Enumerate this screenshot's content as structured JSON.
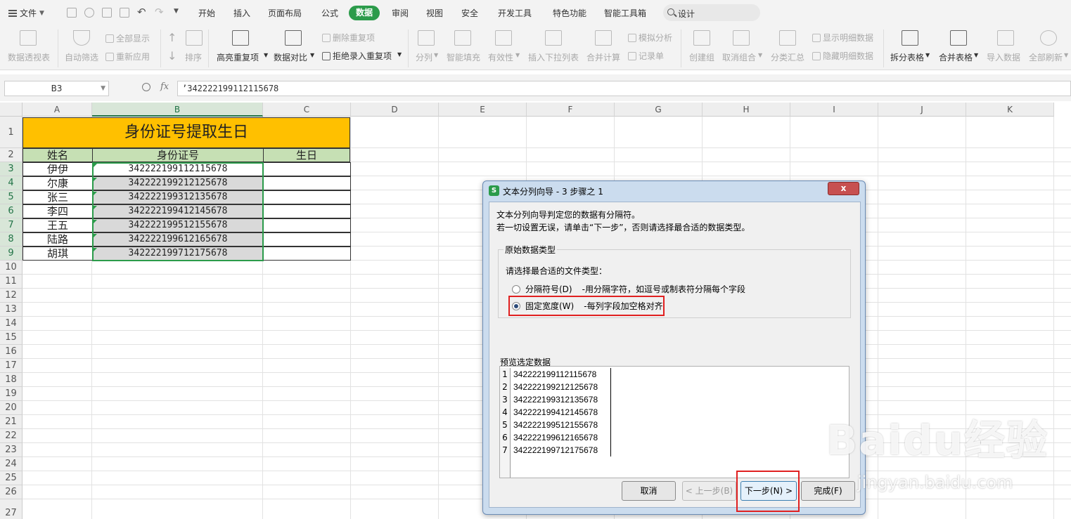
{
  "menubar": {
    "file": "文件",
    "tabs": [
      "开始",
      "插入",
      "页面布局",
      "公式",
      "数据",
      "审阅",
      "视图",
      "安全",
      "开发工具",
      "特色功能",
      "智能工具箱"
    ],
    "active_tab": "数据",
    "search_placeholder": "设计"
  },
  "ribbon": {
    "pivot": "数据透视表",
    "autofilter": "自动筛选",
    "show_all": "全部显示",
    "reapply": "重新应用",
    "sort": "排序",
    "highlight_dup": "高亮重复项",
    "data_compare": "数据对比",
    "remove_dup": "删除重复项",
    "reject_dup": "拒绝录入重复项",
    "split": "分列",
    "smart_fill": "智能填充",
    "validity": "有效性",
    "insert_dropdown": "插入下拉列表",
    "consolidate": "合并计算",
    "simulate": "模拟分析",
    "record": "记录单",
    "create_group": "创建组",
    "ungroup": "取消组合",
    "subtotal": "分类汇总",
    "show_detail": "显示明细数据",
    "hide_detail": "隐藏明细数据",
    "split_table": "拆分表格",
    "merge_table": "合并表格",
    "import_data": "导入数据",
    "refresh_all": "全部刷新"
  },
  "formula_bar": {
    "cell_ref": "B3",
    "fx": "fx",
    "content": "’342222199112115678"
  },
  "sheet": {
    "columns": [
      "A",
      "B",
      "C",
      "D",
      "E",
      "F",
      "G",
      "H",
      "I",
      "J",
      "K"
    ],
    "rows": [
      "1",
      "2",
      "3",
      "4",
      "5",
      "6",
      "7",
      "8",
      "9",
      "10",
      "11",
      "12",
      "13",
      "14",
      "15",
      "16",
      "17",
      "18",
      "19",
      "20",
      "21",
      "22",
      "23",
      "24",
      "25",
      "26",
      "27"
    ],
    "title": "身份证号提取生日",
    "headers": [
      "姓名",
      "身份证号",
      "生日"
    ],
    "records": [
      {
        "name": "伊伊",
        "id": "342222199112115678",
        "birthday": ""
      },
      {
        "name": "尔康",
        "id": "342222199212125678",
        "birthday": ""
      },
      {
        "name": "张三",
        "id": "342222199312135678",
        "birthday": ""
      },
      {
        "name": "李四",
        "id": "342222199412145678",
        "birthday": ""
      },
      {
        "name": "王五",
        "id": "342222199512155678",
        "birthday": ""
      },
      {
        "name": "陆路",
        "id": "342222199612165678",
        "birthday": ""
      },
      {
        "name": "胡琪",
        "id": "342222199712175678",
        "birthday": ""
      }
    ],
    "colors": {
      "title_bg": "#ffc000",
      "header_bg": "#c6e0b4",
      "selection": "#2b9b4a"
    }
  },
  "dialog": {
    "icon": "S",
    "title": "文本分列向导 - 3 步骤之 1",
    "close": "x",
    "line1": "文本分列向导判定您的数据有分隔符。",
    "line2": "若一切设置无误，请单击“下一步”，否则请选择最合适的数据类型。",
    "group_title": "原始数据类型",
    "group_label": "请选择最合适的文件类型：",
    "option_delimited": "分隔符号(D)",
    "option_delimited_desc": "-用分隔字符，如逗号或制表符分隔每个字段",
    "option_fixed": "固定宽度(W)",
    "option_fixed_desc": "-每列字段加空格对齐",
    "selected_option": "fixed",
    "preview_title": "预览选定数据",
    "preview_lines": [
      {
        "n": "1",
        "text": "342222199112115678"
      },
      {
        "n": "2",
        "text": "342222199212125678"
      },
      {
        "n": "3",
        "text": "342222199312135678"
      },
      {
        "n": "4",
        "text": "342222199412145678"
      },
      {
        "n": "5",
        "text": "342222199512155678"
      },
      {
        "n": "6",
        "text": "342222199612165678"
      },
      {
        "n": "7",
        "text": "342222199712175678"
      }
    ],
    "btn_cancel": "取消",
    "btn_prev": "< 上一步(B)",
    "btn_next": "下一步(N) >",
    "btn_finish": "完成(F)"
  },
  "watermark": {
    "main": "Baidu经验",
    "sub": "jingyan.baidu.com"
  }
}
